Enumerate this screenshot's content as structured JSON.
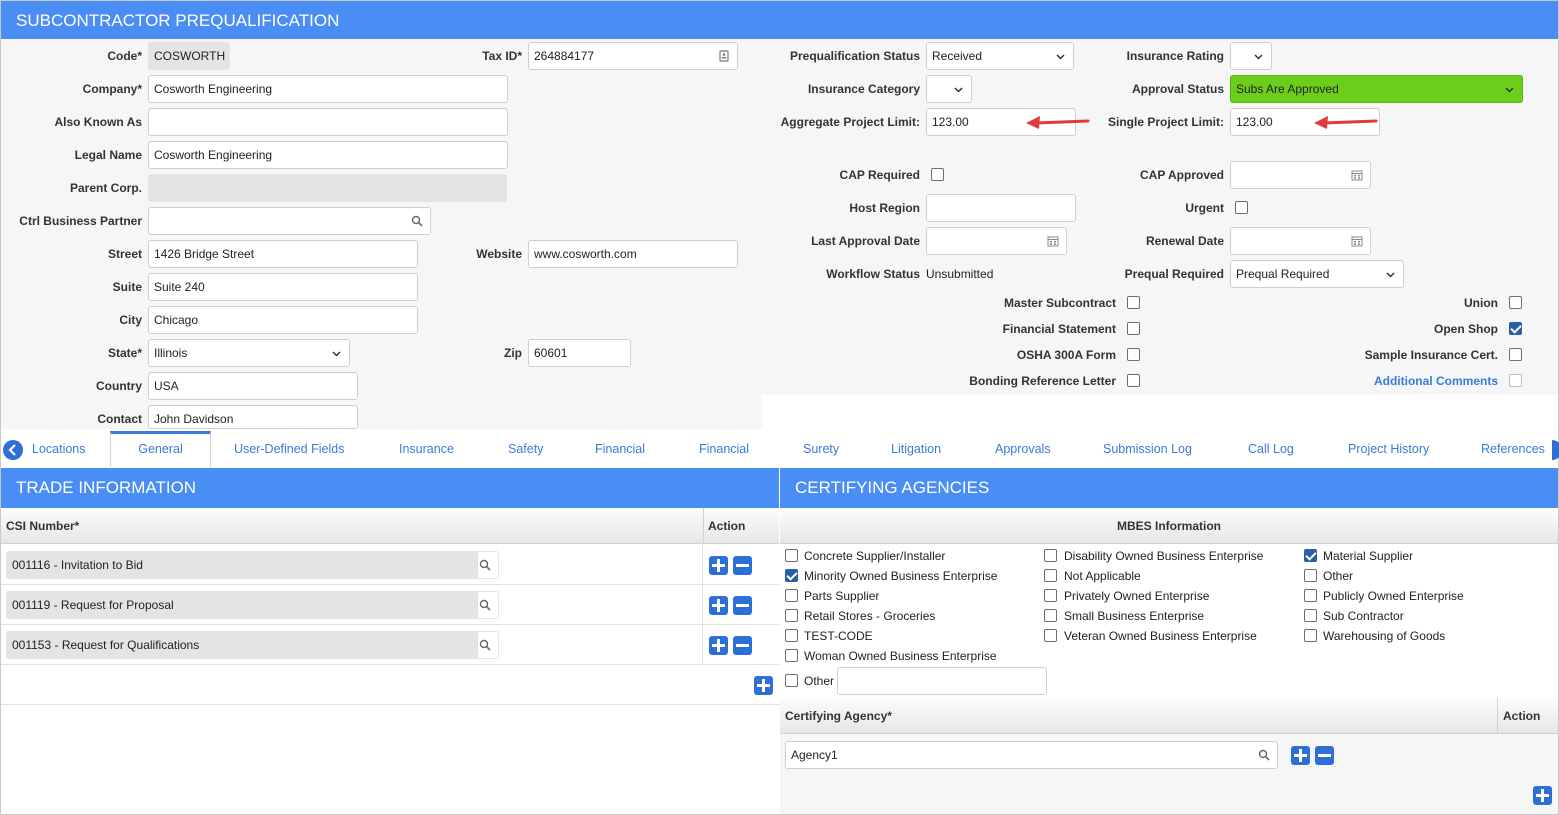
{
  "header": {
    "title": "SUBCONTRACTOR PREQUALIFICATION"
  },
  "left_form": {
    "code_label": "Code*",
    "code_value": "COSWORTH",
    "tax_label": "Tax ID*",
    "tax_value": "264884177",
    "company_label": "Company*",
    "company_value": "Cosworth Engineering",
    "aka_label": "Also Known As",
    "aka_value": "",
    "legal_label": "Legal Name",
    "legal_value": "Cosworth Engineering",
    "parent_label": "Parent Corp.",
    "parent_value": "",
    "ctrl_label": "Ctrl Business Partner",
    "ctrl_value": "",
    "street_label": "Street",
    "street_value": "1426 Bridge Street",
    "website_label": "Website",
    "website_value": "www.cosworth.com",
    "suite_label": "Suite",
    "suite_value": "Suite 240",
    "city_label": "City",
    "city_value": "Chicago",
    "state_label": "State*",
    "state_value": "Illinois",
    "zip_label": "Zip",
    "zip_value": "60601",
    "country_label": "Country",
    "country_value": "USA",
    "contact_label": "Contact",
    "contact_value": "John Davidson"
  },
  "right_form": {
    "preq_status_label": "Prequalification Status",
    "preq_status_value": "Received",
    "ins_rating_label": "Insurance Rating",
    "ins_rating_value": "",
    "ins_cat_label": "Insurance Category",
    "ins_cat_value": "",
    "approval_label": "Approval Status",
    "approval_value": "Subs Are Approved",
    "agg_label": "Aggregate Project Limit:",
    "agg_value": "123.00",
    "single_label": "Single Project Limit:",
    "single_value": "123.00",
    "cap_req_label": "CAP Required",
    "cap_appr_label": "CAP Approved",
    "cap_appr_value": "",
    "host_label": "Host Region",
    "host_value": "",
    "urgent_label": "Urgent",
    "last_appr_label": "Last Approval Date",
    "last_appr_value": "",
    "renewal_label": "Renewal Date",
    "renewal_value": "",
    "workflow_label": "Workflow Status",
    "workflow_value": "Unsubmitted",
    "prequal_req_label": "Prequal Required",
    "prequal_req_value": "Prequal Required",
    "master_label": "Master Subcontract",
    "financial_label": "Financial Statement",
    "osha_label": "OSHA 300A Form",
    "bonding_label": "Bonding Reference Letter",
    "union_label": "Union",
    "open_shop_label": "Open Shop",
    "sample_label": "Sample Insurance Cert.",
    "comments_label": "Additional Comments"
  },
  "tabs": [
    "Locations",
    "General",
    "User-Defined Fields",
    "Insurance",
    "Safety",
    "Financial",
    "Financial",
    "Surety",
    "Litigation",
    "Approvals",
    "Submission Log",
    "Call Log",
    "Project History",
    "References"
  ],
  "trade": {
    "title": "TRADE INFORMATION",
    "col_csi": "CSI Number*",
    "col_action": "Action",
    "rows": [
      "001116 - Invitation to Bid",
      "001119 - Request for Proposal",
      "001153 - Request for Qualifications"
    ]
  },
  "agencies": {
    "title": "CERTIFYING AGENCIES",
    "mbes_header": "MBES Information",
    "col1": [
      "Concrete Supplier/Installer",
      "Minority Owned Business Enterprise",
      "Parts Supplier",
      "Retail Stores - Groceries",
      "TEST-CODE",
      "Woman Owned Business Enterprise"
    ],
    "col2": [
      "Disability Owned Business Enterprise",
      "Not Applicable",
      "Privately Owned Enterprise",
      "Small Business Enterprise",
      "Veteran Owned Business Enterprise"
    ],
    "col3": [
      "Material Supplier",
      "Other",
      "Publicly Owned Enterprise",
      "Sub Contractor",
      "Warehousing of Goods"
    ],
    "other_label": "Other",
    "agency_col": "Certifying Agency*",
    "agency_action": "Action",
    "agency_value": "Agency1"
  },
  "colors": {
    "accent": "#4a8ef5",
    "approved_green": "#6dcd1b",
    "link": "#3a7bd5",
    "arrow": "#e03a3a"
  }
}
